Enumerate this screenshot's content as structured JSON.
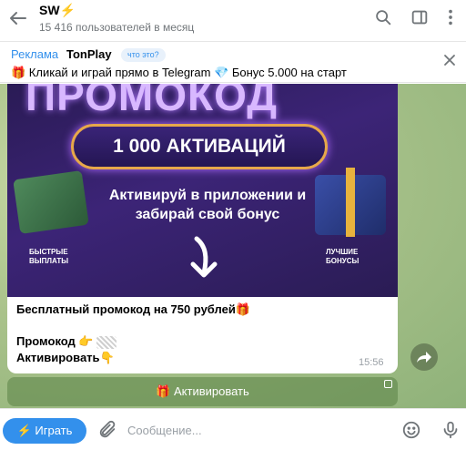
{
  "header": {
    "channel_name": "SW⚡",
    "subscribers": "15 416 пользователей в месяц"
  },
  "ad": {
    "label": "Реклама",
    "title": "TonPlay",
    "what_is_this": "что это?",
    "text": "🎁 Кликай и играй прямо в Telegram 💎 Бонус 5.000 на старт"
  },
  "promo_image": {
    "headline": "ПРОМОКОД",
    "activations": "1 000 АКТИВАЦИЙ",
    "subtitle": "Активируй в приложении и забирай свой бонус",
    "left_caption": "БЫСТРЫЕ\nВЫПЛАТЫ",
    "right_caption": "ЛУЧШИЕ\nБОНУСЫ"
  },
  "message": {
    "title": "Бесплатный промокод на 750 рублей🎁",
    "promo_line": "Промокод 👉",
    "activate_line": "Активировать👇",
    "time": "15:56"
  },
  "inline_button": {
    "label": "🎁 Активировать"
  },
  "composer": {
    "play_label": "⚡ Играть",
    "placeholder": "Сообщение..."
  }
}
